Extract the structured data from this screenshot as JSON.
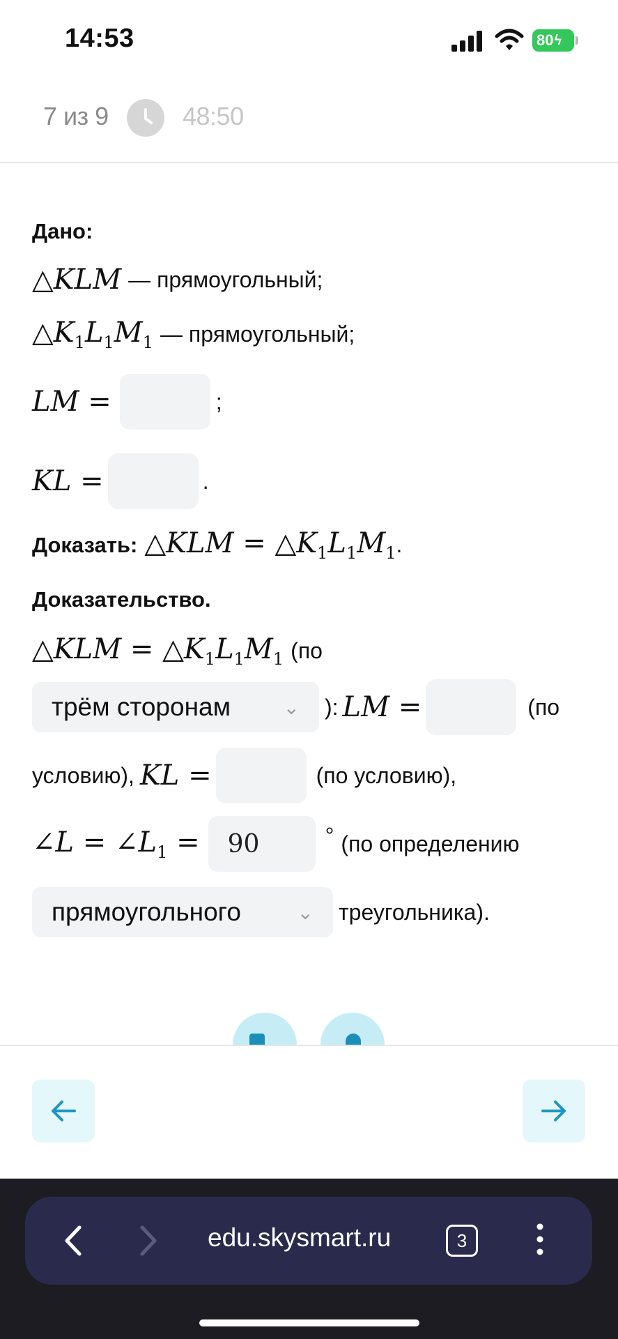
{
  "status_bar": {
    "time": "14:53",
    "battery": "80"
  },
  "test_header": {
    "progress": "7 из 9",
    "timer": "48:50"
  },
  "given": {
    "label": "Дано:",
    "line1_math": "KLM",
    "line1_text": "— прямоугольный;",
    "line2_text": "— прямоугольный;",
    "lm_label": "LM",
    "lm_value": "",
    "kl_label": "KL",
    "kl_value": ""
  },
  "prove": {
    "label": "Доказать:",
    "period": "."
  },
  "proof": {
    "label": "Доказательство.",
    "po_open": "(по",
    "select1_value": "трём сторонам",
    "after_select1": "):",
    "lm_value": "",
    "po_close_part": "(по",
    "usloviyu": "условию),",
    "kl_value": "",
    "po_usloviyu": "(по условию),",
    "angle_value": "90",
    "degree": "°",
    "po_opredeleniyu": "(по определению",
    "select2_value": "прямоугольного",
    "treugolnika": "треугольника)."
  },
  "navigation": {
    "prev_icon": "arrow-left-icon",
    "next_icon": "arrow-right-icon"
  },
  "browser": {
    "url": "edu.skysmart.ru",
    "tabs_count": "3"
  },
  "colors": {
    "accent": "#1e95c0",
    "nav_bg": "#e4f7fb",
    "input_bg": "#f1f3f4",
    "browser_bg": "#2a2b4c",
    "battery": "#34c759"
  }
}
